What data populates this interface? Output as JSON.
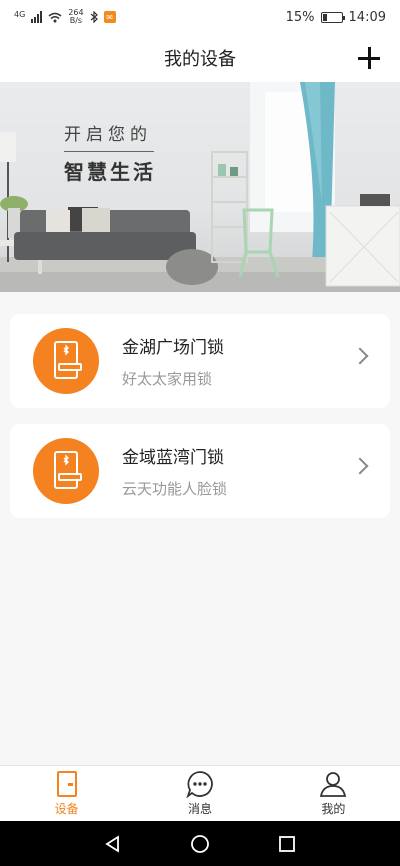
{
  "status_bar": {
    "net_type": "4G",
    "speed_value": "264",
    "speed_unit": "B/s",
    "battery": "15%",
    "time": "14:09"
  },
  "header": {
    "title": "我的设备"
  },
  "banner": {
    "line1": "开启您的",
    "line2": "智慧生活"
  },
  "devices": [
    {
      "name": "金湖广场门锁",
      "desc": "好太太家用锁"
    },
    {
      "name": "金域蓝湾门锁",
      "desc": "云天功能人脸锁"
    }
  ],
  "bottom_nav": [
    {
      "label": "设备",
      "icon": "door-lock-icon",
      "active": true
    },
    {
      "label": "消息",
      "icon": "chat-bubble-icon",
      "active": false
    },
    {
      "label": "我的",
      "icon": "person-icon",
      "active": false
    }
  ],
  "colors": {
    "accent": "#f58220"
  }
}
